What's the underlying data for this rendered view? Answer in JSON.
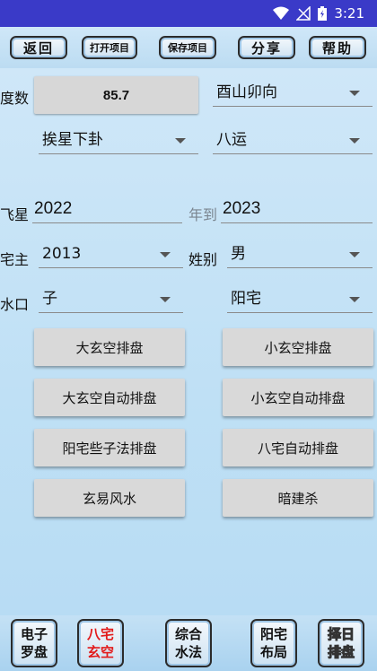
{
  "status_bar": {
    "time": "3:21",
    "icons": [
      "wifi-icon",
      "signal-icon",
      "battery-icon"
    ]
  },
  "toolbar": {
    "back": "返回",
    "open_project": "打开项目",
    "save_project": "保存项目",
    "share": "分享",
    "help": "帮助"
  },
  "form": {
    "degree_label": "度数",
    "degree_value": "85.7",
    "direction": "酉山卯向",
    "star_method": "挨星下卦",
    "period": "八运",
    "flying_star_label": "飞星",
    "year_from": "2022",
    "year_to_label": "年到",
    "year_to": "2023",
    "owner_label": "宅主",
    "owner_year": "2013",
    "gender_label": "姓别",
    "gender": "男",
    "water_label": "水口",
    "water": "子",
    "house_type": "阳宅"
  },
  "actions": {
    "big_xuankong": "大玄空排盘",
    "small_xuankong": "小玄空排盘",
    "big_xuankong_auto": "大玄空自动排盘",
    "small_xuankong_auto": "小玄空自动排盘",
    "yangzhai_method": "阳宅些子法排盘",
    "bazhai_auto": "八宅自动排盘",
    "xuanyi_fengshui": "玄易风水",
    "anjiansha": "暗建杀"
  },
  "bottom_nav": [
    {
      "line1": "电子",
      "line2": "罗盘"
    },
    {
      "line1": "八宅",
      "line2": "玄空"
    },
    {
      "line1": "综合",
      "line2": "水法"
    },
    {
      "line1": "阳宅",
      "line2": "布局"
    },
    {
      "line1": "择日",
      "line2": "排盘"
    }
  ],
  "colors": {
    "status_bar": "#3a3ac8",
    "background": "#cfe6f7",
    "active_nav_text": "#e21b1b"
  }
}
